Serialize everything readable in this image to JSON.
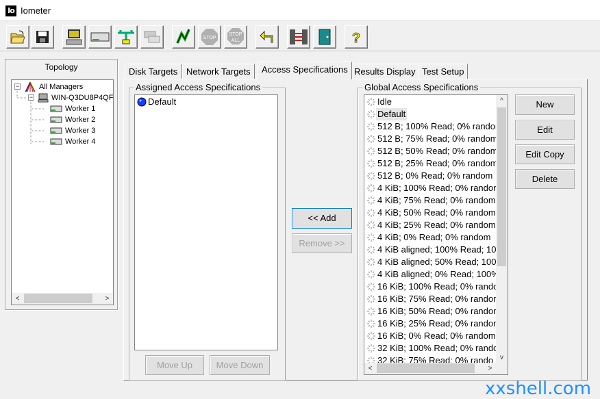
{
  "window": {
    "app_logo": "Io",
    "title": "Iometer"
  },
  "toolbar": {
    "buttons": [
      {
        "name": "open-icon"
      },
      {
        "name": "save-icon"
      },
      {
        "name": "display-icon"
      },
      {
        "name": "new-disk-worker-icon"
      },
      {
        "name": "new-network-worker-icon"
      },
      {
        "name": "duplicate-worker-icon"
      },
      {
        "name": "start-tests-icon"
      },
      {
        "name": "stop-icon",
        "label": "STOP"
      },
      {
        "name": "stop-all-icon",
        "label": "STOP ALL"
      },
      {
        "name": "reset-workers-icon"
      },
      {
        "name": "disconnect-managers-icon"
      },
      {
        "name": "exit-icon"
      },
      {
        "name": "help-icon",
        "label": "?"
      }
    ]
  },
  "topology": {
    "title": "Topology",
    "tree": [
      {
        "label": "All Managers",
        "expander": "−"
      },
      {
        "label": "WIN-Q3DU8P4QF",
        "expander": "−"
      },
      {
        "label": "Worker 1"
      },
      {
        "label": "Worker 2"
      },
      {
        "label": "Worker 3"
      },
      {
        "label": "Worker 4"
      }
    ]
  },
  "tabs": [
    {
      "label": "Disk Targets"
    },
    {
      "label": "Network Targets"
    },
    {
      "label": "Access Specifications"
    },
    {
      "label": "Results Display"
    },
    {
      "label": "Test Setup"
    }
  ],
  "assigned": {
    "label": "Assigned Access Specifications",
    "items": [
      "Default"
    ],
    "move_up": "Move Up",
    "move_down": "Move Down"
  },
  "middle": {
    "add": "<< Add",
    "remove": "Remove >>"
  },
  "global": {
    "label": "Global Access Specifications",
    "items": [
      "Idle",
      "Default",
      "512 B; 100% Read; 0% random",
      "512 B; 75% Read; 0% random",
      "512 B; 50% Read; 0% random",
      "512 B; 25% Read; 0% random",
      "512 B; 0% Read; 0% random",
      "4 KiB; 100% Read; 0% random",
      "4 KiB; 75% Read; 0% random",
      "4 KiB; 50% Read; 0% random",
      "4 KiB; 25% Read; 0% random",
      "4 KiB; 0% Read; 0% random",
      "4 KiB aligned; 100% Read; 10",
      "4 KiB aligned; 50% Read; 100",
      "4 KiB aligned; 0% Read; 100%",
      "16 KiB; 100% Read; 0% rando",
      "16 KiB; 75% Read; 0% random",
      "16 KiB; 50% Read; 0% random",
      "16 KiB; 25% Read; 0% random",
      "16 KiB; 0% Read; 0% random",
      "32 KiB; 100% Read; 0% rando",
      "32 KiB; 75% Read; 0% rando"
    ],
    "selected_index": 1
  },
  "actions": {
    "new": "New",
    "edit": "Edit",
    "edit_copy": "Edit Copy",
    "delete": "Delete"
  },
  "scroll_arrows": {
    "left": "<",
    "right": ">",
    "up": "^",
    "down": "v"
  },
  "watermark": "xxshell.com",
  "colors": {
    "selection_bg": "#e6e6e6",
    "default_spec_icon": "#1a3cff",
    "watermark": "#1e90ff"
  }
}
